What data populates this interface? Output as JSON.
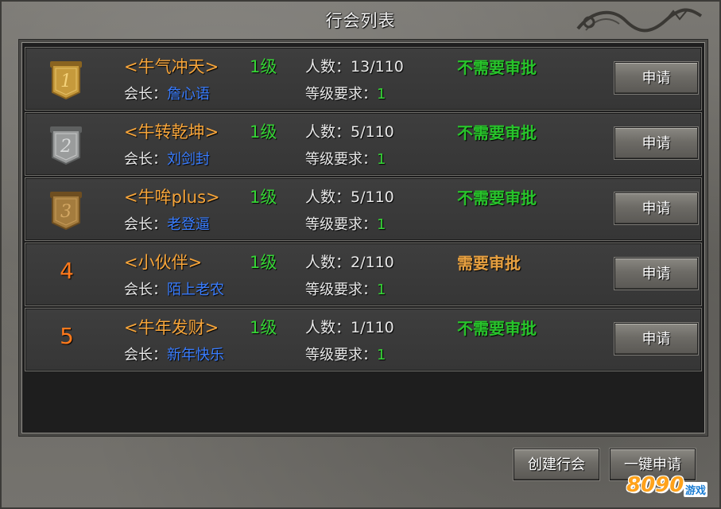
{
  "window": {
    "title": "行会列表"
  },
  "labels": {
    "leader_prefix": "会长：",
    "members_prefix": "人数：",
    "level_req_prefix": "等级要求："
  },
  "guilds": [
    {
      "rank": "1",
      "rank_style": "gold-banner",
      "name": "<牛气冲天>",
      "level": "1级",
      "members": "13/110",
      "approval": "不需要审批",
      "leader": "詹心语",
      "level_req": "1",
      "apply": "申请"
    },
    {
      "rank": "2",
      "rank_style": "silver-banner",
      "name": "<牛转乾坤>",
      "level": "1级",
      "members": "5/110",
      "approval": "不需要审批",
      "leader": "刘剑封",
      "level_req": "1",
      "apply": "申请"
    },
    {
      "rank": "3",
      "rank_style": "bronze-banner",
      "name": "<牛哞plus>",
      "level": "1级",
      "members": "5/110",
      "approval": "不需要审批",
      "leader": "老登逼",
      "level_req": "1",
      "apply": "申请"
    },
    {
      "rank": "4",
      "rank_style": "plain-number",
      "name": "<小伙伴>",
      "level": "1级",
      "members": "2/110",
      "approval": "需要审批",
      "leader": "陌上老农",
      "level_req": "1",
      "apply": "申请"
    },
    {
      "rank": "5",
      "rank_style": "plain-number",
      "name": "<牛年发财>",
      "level": "1级",
      "members": "1/110",
      "approval": "不需要审批",
      "leader": "新年快乐",
      "level_req": "1",
      "apply": "申请"
    }
  ],
  "footer": {
    "create_label": "创建行会",
    "oneclick_label": "一键申请"
  },
  "watermark": {
    "brand": "8090",
    "suffix": "游戏"
  },
  "colors": {
    "guild_name": "#f7a53a",
    "level": "#35d435",
    "no_approval": "#28c42b",
    "need_approval": "#e7a040",
    "leader_name": "#3a7dff",
    "rank_number": "#ff7a1c"
  }
}
